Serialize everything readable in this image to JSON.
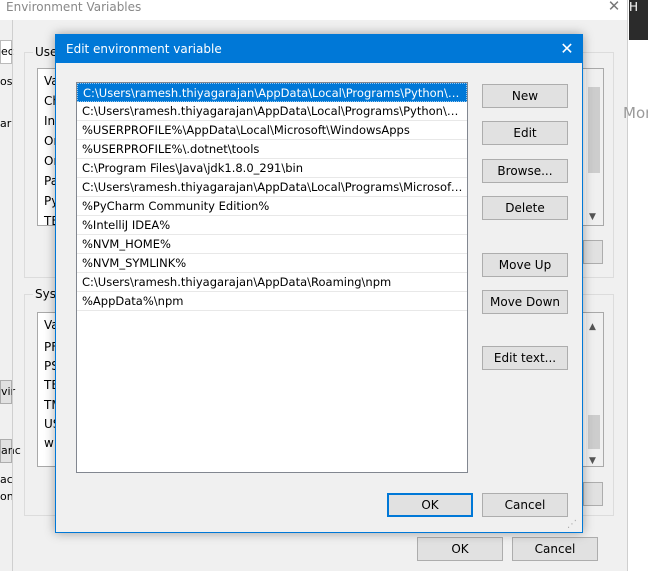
{
  "background_window": {
    "title": "Environment Variables",
    "user_group_label": "User",
    "system_group_label": "Syste",
    "user_list_visible": [
      "Va",
      "Ch",
      "Int",
      "On",
      "On",
      "Pa",
      "Py",
      "TE"
    ],
    "system_list_visible": [
      "Va",
      "PF",
      "PS",
      "TE",
      "TM",
      "US",
      "wi"
    ],
    "ok_label": "OK",
    "cancel_label": "Cancel"
  },
  "background_edge_text": {
    "left_clips": [
      "ec",
      "os",
      "ar",
      "vir",
      "anc",
      "ac",
      "on"
    ],
    "right_top": "H",
    "right_more": "Mor"
  },
  "dialog": {
    "title": "Edit environment variable",
    "close_glyph": "✕",
    "entries": [
      "C:\\Users\\ramesh.thiyagarajan\\AppData\\Local\\Programs\\Python\\Pyth...",
      "C:\\Users\\ramesh.thiyagarajan\\AppData\\Local\\Programs\\Python\\Pyth...",
      "%USERPROFILE%\\AppData\\Local\\Microsoft\\WindowsApps",
      "%USERPROFILE%\\.dotnet\\tools",
      "C:\\Program Files\\Java\\jdk1.8.0_291\\bin",
      "C:\\Users\\ramesh.thiyagarajan\\AppData\\Local\\Programs\\Microsoft VS ...",
      "%PyCharm Community Edition%",
      "%IntelliJ IDEA%",
      "%NVM_HOME%",
      "%NVM_SYMLINK%",
      "C:\\Users\\ramesh.thiyagarajan\\AppData\\Roaming\\npm",
      "%AppData%\\npm"
    ],
    "selected_index": 0,
    "buttons": {
      "new": "New",
      "edit": "Edit",
      "browse": "Browse...",
      "delete": "Delete",
      "move_up": "Move Up",
      "move_down": "Move Down",
      "edit_text": "Edit text...",
      "ok": "OK",
      "cancel": "Cancel"
    }
  },
  "colors": {
    "accent": "#0078d7",
    "dialog_bg": "#f0f0f0",
    "button_bg": "#e1e1e1"
  }
}
